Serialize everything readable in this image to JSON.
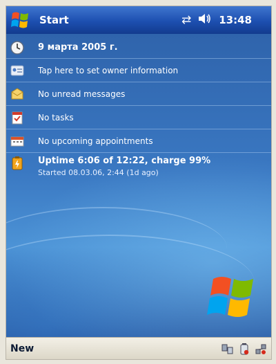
{
  "titlebar": {
    "start_label": "Start",
    "clock": "13:48",
    "icons": [
      "sync-arrows-icon",
      "speaker-icon"
    ]
  },
  "today": {
    "date": "9 марта 2005 г.",
    "owner": "Tap here to set owner information",
    "messages": "No unread messages",
    "tasks": "No tasks",
    "appointments": "No upcoming appointments",
    "uptime_main": "Uptime 6:06 of 12:22, charge 99%",
    "uptime_sub": "Started 08.03.06, 2:44 (1d ago)"
  },
  "menubar": {
    "new_label": "New",
    "tray_icons": [
      "connectivity-icon",
      "battery-icon",
      "network-icon"
    ]
  },
  "colors": {
    "titlebar": "#1d4fb0",
    "background": "#3a78c2",
    "menubar": "#e6e2d6"
  }
}
